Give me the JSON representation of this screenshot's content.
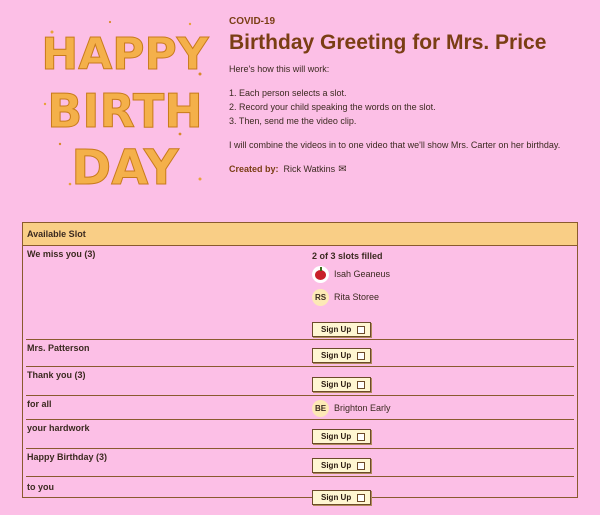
{
  "hero": {
    "lines": [
      "HAPPY",
      "BIRTH",
      "DAY"
    ]
  },
  "header": {
    "category": "COVID-19",
    "title": "Birthday Greeting for Mrs. Price",
    "intro": "Here's how this will work:",
    "steps": [
      "1. Each person selects a slot.",
      "2. Record your child speaking the words on the slot.",
      "3. Then, send me the video clip."
    ],
    "note": "I will combine the videos in to one video that we'll show Mrs. Carter on her birthday.",
    "created_by_label": "Created by:",
    "created_by_name": "Rick Watkins",
    "mail_icon": "✉"
  },
  "table": {
    "header": "Available Slot",
    "sign_up_label": "Sign Up",
    "rows": [
      {
        "label": "We miss you (3)",
        "filled": "2 of 3 slots filled",
        "people": [
          {
            "initials": "",
            "name": "Isah Geaneus",
            "avatar": "apple-icon"
          },
          {
            "initials": "RS",
            "name": "Rita Storee"
          }
        ]
      },
      {
        "label": "Mrs. Patterson"
      },
      {
        "label": "Thank you (3)"
      },
      {
        "label": "for all",
        "people": [
          {
            "initials": "BE",
            "name": "Brighton Early"
          }
        ]
      },
      {
        "label": "your hardwork"
      },
      {
        "label": "Happy Birthday (3)"
      },
      {
        "label": "to you"
      }
    ]
  },
  "colors": {
    "background": "#fcbfe6",
    "header_bg": "#f9ce86",
    "title": "#7a3e14"
  }
}
